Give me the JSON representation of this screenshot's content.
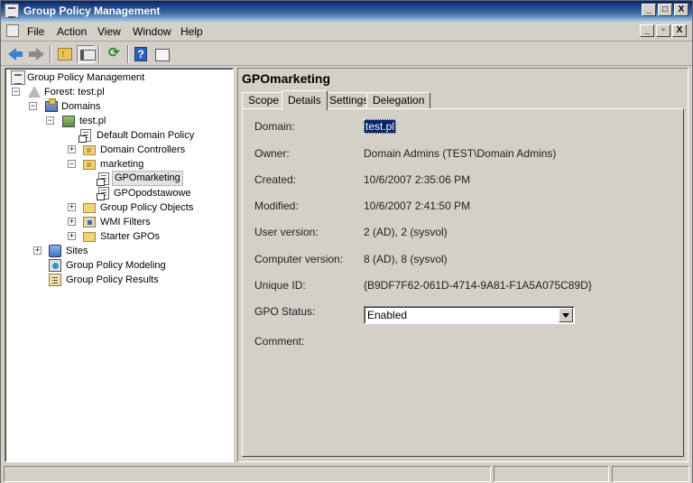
{
  "window": {
    "title": "Group Policy Management",
    "caption_buttons": [
      "_",
      "□",
      "X"
    ]
  },
  "menubar": {
    "items": [
      "File",
      "Action",
      "View",
      "Window",
      "Help"
    ],
    "mdi_buttons": [
      "_",
      "▫",
      "X"
    ]
  },
  "toolbar": {
    "buttons": [
      "back-icon",
      "forward-icon",
      "up-folder-icon",
      "show-hide-tree-icon",
      "refresh-icon",
      "help-icon",
      "properties-icon"
    ]
  },
  "tree": {
    "root": "Group Policy Management",
    "forest": "Forest: test.pl",
    "domains": "Domains",
    "domain": "test.pl",
    "default_policy": "Default Domain Policy",
    "domain_controllers": "Domain Controllers",
    "marketing": "marketing",
    "gpo_marketing": "GPOmarketing",
    "gpo_podstawowe": "GPOpodstawowe",
    "gpo_objects": "Group Policy Objects",
    "wmi_filters": "WMI Filters",
    "starter_gpos": "Starter GPOs",
    "sites": "Sites",
    "modeling": "Group Policy Modeling",
    "results": "Group Policy Results"
  },
  "details": {
    "title": "GPOmarketing",
    "tabs": [
      "Scope",
      "Details",
      "Settings",
      "Delegation"
    ],
    "active_tab": "Details",
    "labels": {
      "domain": "Domain:",
      "owner": "Owner:",
      "created": "Created:",
      "modified": "Modified:",
      "user_version": "User version:",
      "computer_version": "Computer version:",
      "unique_id": "Unique ID:",
      "gpo_status": "GPO Status:",
      "comment": "Comment:"
    },
    "values": {
      "domain": "test.pl",
      "owner": "Domain Admins (TEST\\Domain Admins)",
      "created": "10/6/2007 2:35:06 PM",
      "modified": "10/6/2007 2:41:50 PM",
      "user_version": "2 (AD), 2 (sysvol)",
      "computer_version": "8 (AD), 8 (sysvol)",
      "unique_id": "{B9DF7F62-061D-4714-9A81-F1A5A075C89D}",
      "gpo_status": "Enabled"
    }
  }
}
